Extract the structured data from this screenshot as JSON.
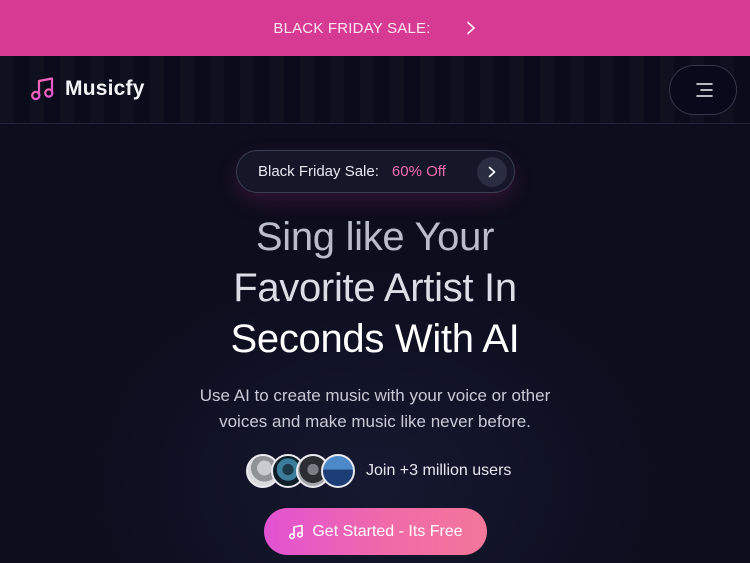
{
  "banner": {
    "text": "BLACK FRIDAY SALE:",
    "icon": "chevron-right-icon"
  },
  "header": {
    "brand_name": "Musicfy",
    "logo_icon": "music-note-icon",
    "menu_icon": "hamburger-menu-icon"
  },
  "hero": {
    "sale_pill": {
      "label": "Black Friday Sale:",
      "offer": "60% Off",
      "icon": "chevron-right-icon"
    },
    "title_lines": [
      "Sing like Your",
      "Favorite Artist In",
      "Seconds With AI"
    ],
    "subtitle_lines": [
      "Use AI to create music with your voice or other",
      "voices and make music like never before."
    ],
    "users_text": "Join +3 million users",
    "cta_label": "Get Started - Its Free",
    "cta_icon": "music-note-icon"
  },
  "colors": {
    "banner_bg": "#d63a92",
    "page_bg": "#0c0d1d",
    "accent_pink": "#f06bb1",
    "cta_gradient_start": "#e152d3",
    "cta_gradient_end": "#f3779a"
  }
}
